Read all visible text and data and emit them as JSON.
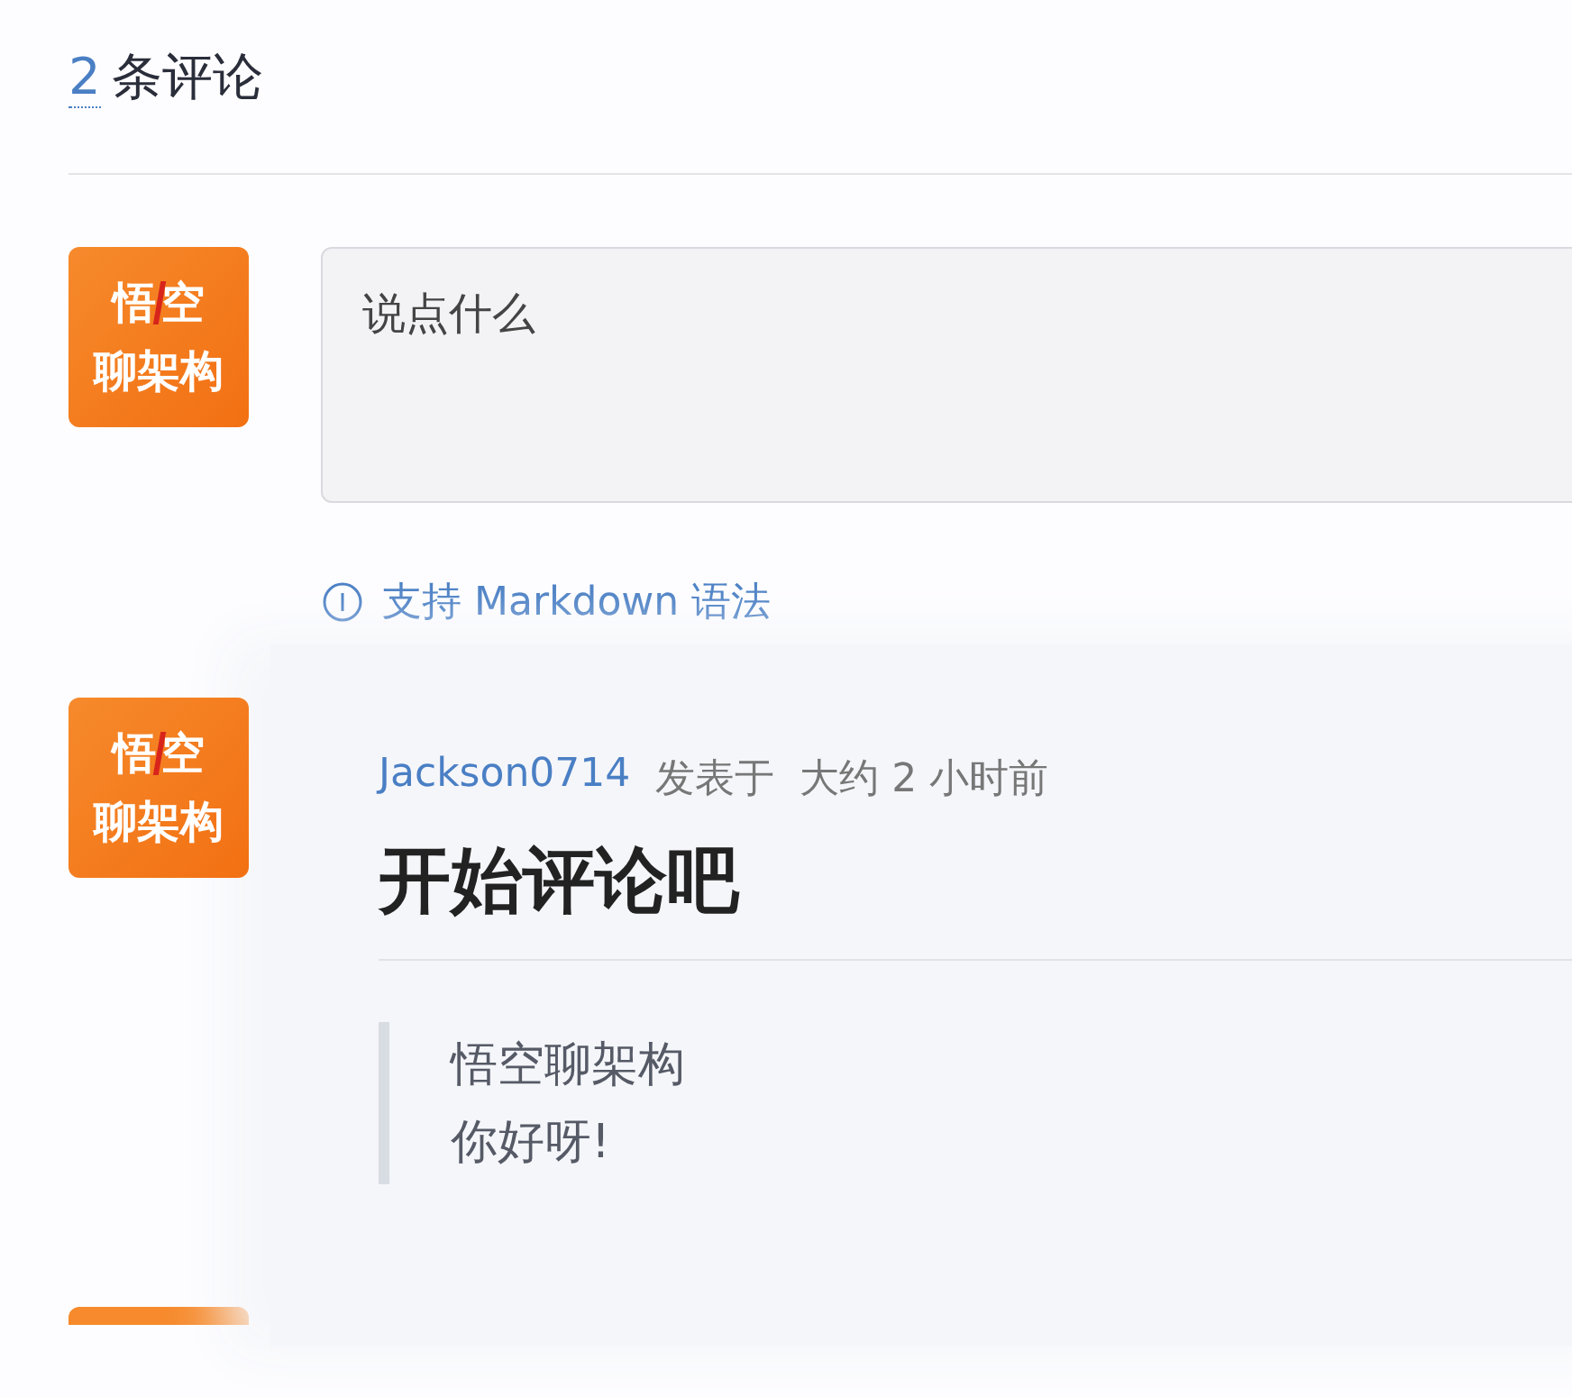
{
  "header": {
    "count": "2",
    "label": "条评论"
  },
  "composer": {
    "avatar": {
      "top": [
        "悟",
        "空"
      ],
      "bottom": "聊架构"
    },
    "placeholder": "说点什么",
    "hint": "支持 Markdown 语法"
  },
  "comments": [
    {
      "avatar": {
        "top": [
          "悟",
          "空"
        ],
        "bottom": "聊架构"
      },
      "author": "Jackson0714",
      "posted": "发表于",
      "time": "大约 2 小时前",
      "title": "开始评论吧",
      "quote": [
        "悟空聊架构",
        "你好呀!"
      ]
    }
  ],
  "more_below": true
}
